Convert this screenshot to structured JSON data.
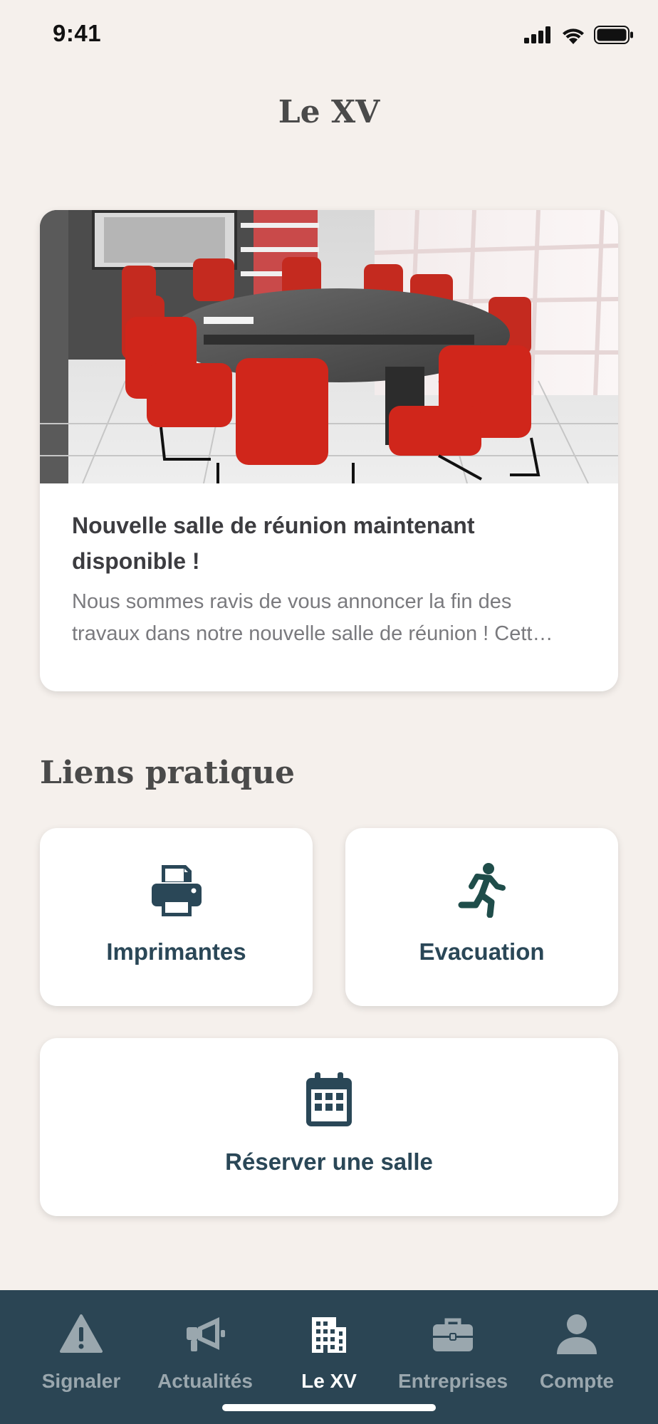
{
  "status": {
    "time": "9:41"
  },
  "header": {
    "title": "Le XV"
  },
  "news": {
    "title": "Nouvelle salle de réunion maintenant disponible !",
    "excerpt_line1": "Nous sommes ravis de vous annoncer la fin des",
    "excerpt_line2": "travaux dans notre nouvelle salle de réunion ! Cett…"
  },
  "links": {
    "section_title": "Liens pratique",
    "items": [
      {
        "label": "Imprimantes",
        "icon": "printer-icon"
      },
      {
        "label": "Evacuation",
        "icon": "running-person-icon"
      },
      {
        "label": "Réserver une salle",
        "icon": "calendar-icon"
      }
    ]
  },
  "tabbar": {
    "active": "Le XV",
    "items": [
      {
        "label": "Signaler",
        "icon": "warning-icon"
      },
      {
        "label": "Actualités",
        "icon": "megaphone-icon"
      },
      {
        "label": "Le XV",
        "icon": "building-icon"
      },
      {
        "label": "Entreprises",
        "icon": "briefcase-icon"
      },
      {
        "label": "Compte",
        "icon": "user-icon"
      }
    ]
  },
  "colors": {
    "background": "#f5f0ec",
    "accent": "#2a4757",
    "tabbar": "#2b4554",
    "tab_inactive": "#9aa7ae",
    "tab_active": "#ffffff"
  }
}
